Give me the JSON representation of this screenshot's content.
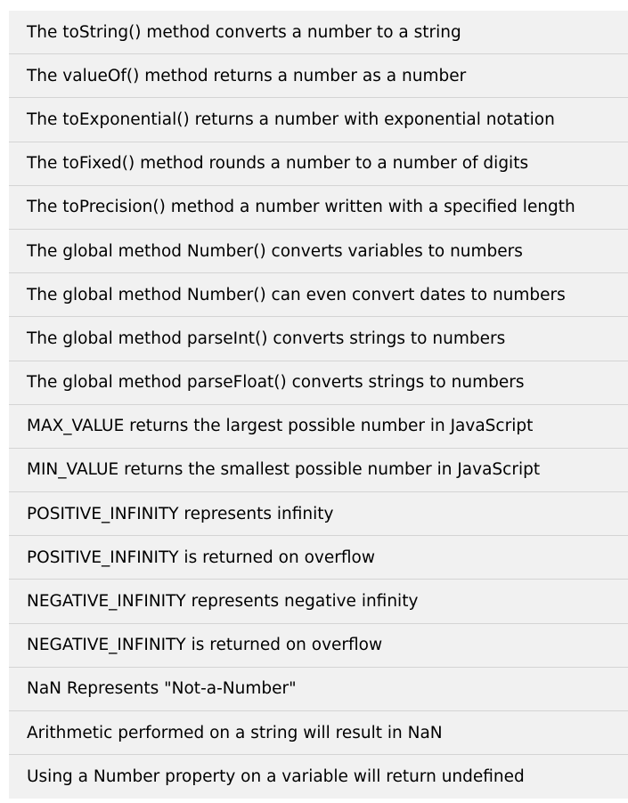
{
  "examples": {
    "items": [
      "The toString() method converts a number to a string",
      "The valueOf() method returns a number as a number",
      "The toExponential() returns a number with exponential notation",
      "The toFixed() method rounds a number to a number of digits",
      "The toPrecision() method a number written with a specified length",
      "The global method Number() converts variables to numbers",
      "The global method Number() can even convert dates to numbers",
      "The global method parseInt() converts strings to numbers",
      "The global method parseFloat() converts strings to numbers",
      "MAX_VALUE returns the largest possible number in JavaScript",
      "MIN_VALUE returns the smallest possible number in JavaScript",
      "POSITIVE_INFINITY represents infinity",
      "POSITIVE_INFINITY is returned on overflow",
      "NEGATIVE_INFINITY represents negative infinity",
      "NEGATIVE_INFINITY is returned on overflow",
      "NaN Represents \"Not-a-Number\"",
      "Arithmetic performed on a string will result in NaN",
      "Using a Number property on a variable will return undefined"
    ]
  }
}
